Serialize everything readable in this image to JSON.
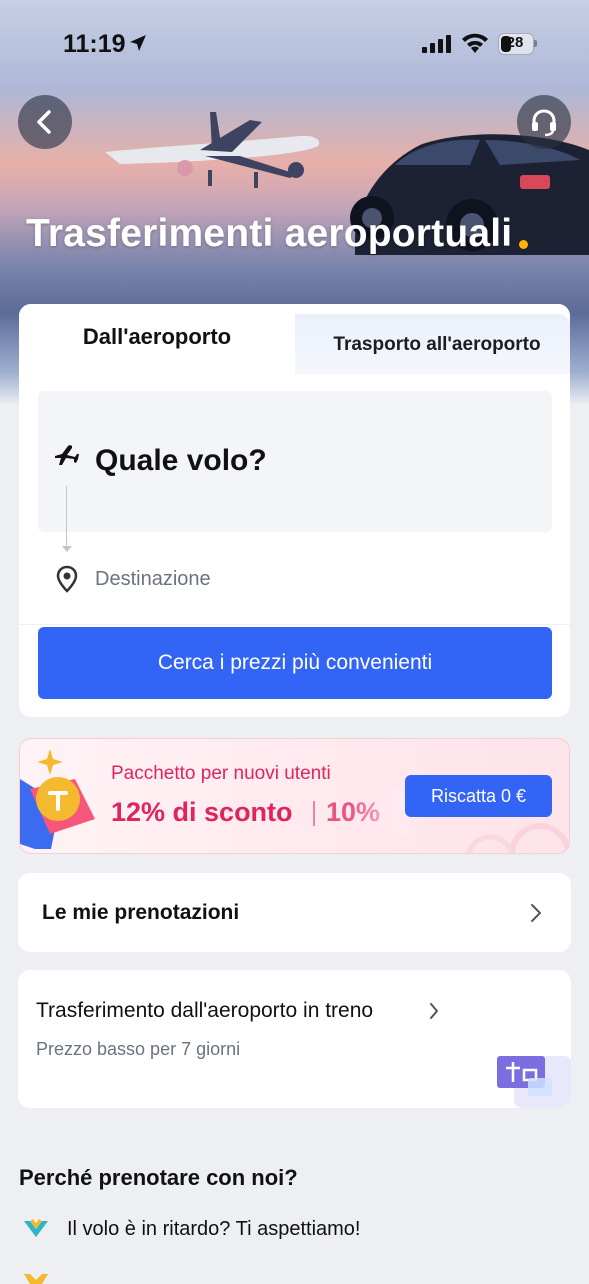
{
  "status_bar": {
    "time": "11:19",
    "battery": "28"
  },
  "header": {
    "title": "Trasferimenti aeroportuali"
  },
  "tabs": [
    {
      "label": "Dall'aeroporto",
      "active": true
    },
    {
      "label": "Trasporto all'aeroporto",
      "active": false
    }
  ],
  "search": {
    "flight_prompt": "Quale volo?",
    "destination_placeholder": "Destinazione",
    "cta_label": "Cerca i prezzi più convenienti"
  },
  "promo": {
    "title": "Pacchetto per nuovi utenti",
    "discount_1": "12% di sconto",
    "discount_2": "10%",
    "button_label": "Riscatta 0 €"
  },
  "bookings": {
    "label": "Le mie prenotazioni"
  },
  "train_transfer": {
    "title": "Trasferimento dall'aeroporto in treno",
    "subtitle": "Prezzo basso per 7 giorni"
  },
  "why_us": {
    "title": "Perché prenotare con noi?",
    "reasons": [
      "Il volo è in ritardo? Ti aspettiamo!"
    ]
  },
  "colors": {
    "primary": "#3264f5",
    "promo_text": "#e0245e",
    "background": "#edeff3"
  }
}
